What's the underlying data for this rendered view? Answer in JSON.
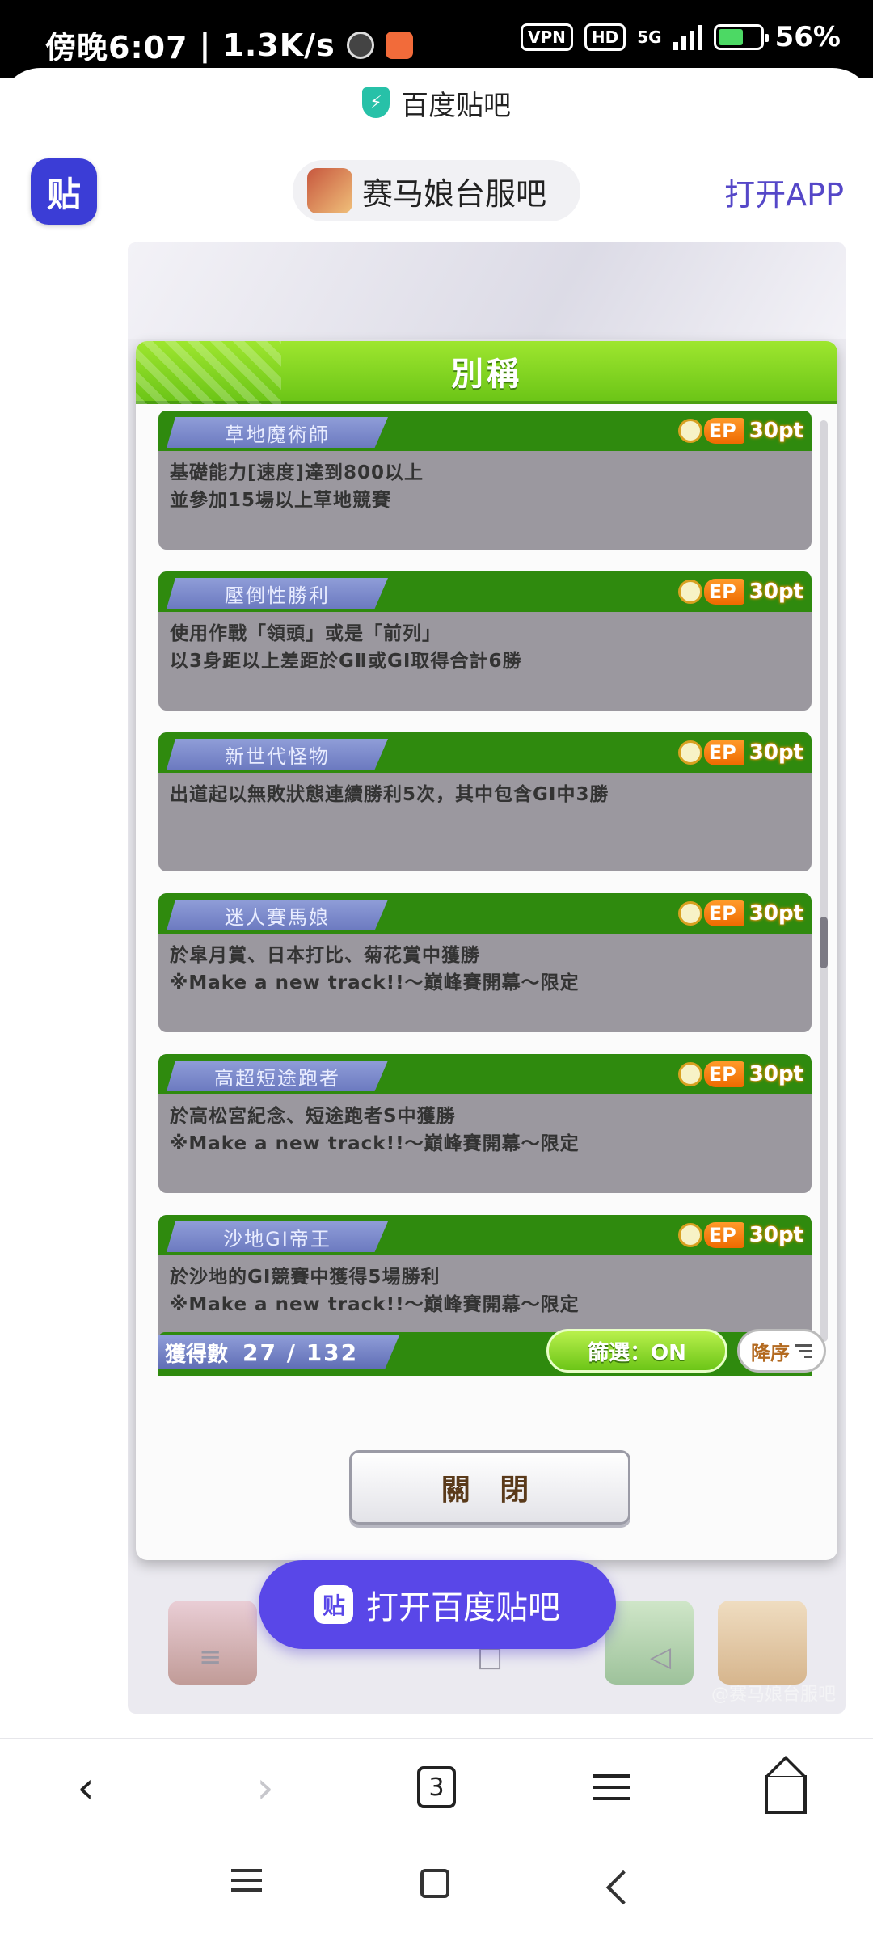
{
  "status_bar": {
    "time": "傍晚6:07",
    "speed": "1.3K/s",
    "vpn": "VPN",
    "hd": "HD",
    "network": "5G",
    "battery": "56%"
  },
  "browser": {
    "site_title": "百度贴吧"
  },
  "tieba_header": {
    "logo_glyph": "贴",
    "forum_name": "赛马娘台服吧",
    "open_app": "打开APP"
  },
  "dialog": {
    "title": "別稱",
    "close_label": "關 閉",
    "cards": [
      {
        "name": "草地魔術師",
        "ep": "EP",
        "points": "30pt",
        "line1": "基礎能力[速度]達到800以上",
        "line2": "並參加15場以上草地競賽"
      },
      {
        "name": "壓倒性勝利",
        "ep": "EP",
        "points": "30pt",
        "line1": "使用作戰「領頭」或是「前列」",
        "line2": "以3身距以上差距於GⅡ或GⅠ取得合計6勝"
      },
      {
        "name": "新世代怪物",
        "ep": "EP",
        "points": "30pt",
        "line1": "出道起以無敗狀態連續勝利5次，其中包含GⅠ中3勝",
        "line2": ""
      },
      {
        "name": "迷人賽馬娘",
        "ep": "EP",
        "points": "30pt",
        "line1": "於皐月賞、日本打比、菊花賞中獲勝",
        "line2": "※Make a new track!!～巔峰賽開幕～限定"
      },
      {
        "name": "高超短途跑者",
        "ep": "EP",
        "points": "30pt",
        "line1": "於高松宮紀念、短途跑者S中獲勝",
        "line2": "※Make a new track!!～巔峰賽開幕～限定"
      },
      {
        "name": "沙地GⅠ帝王",
        "ep": "EP",
        "points": "30pt",
        "line1": "於沙地的GⅠ競賽中獲得5場勝利",
        "line2": "※Make a new track!!～巔峰賽開幕～限定"
      }
    ],
    "count_label": "獲得數",
    "count_value": "27 / 132",
    "filter_label": "篩選：ON",
    "sort_label": "降序"
  },
  "watermark": "@赛马娘台服吧",
  "open_tieba_button": {
    "icon_glyph": "贴",
    "label": "打开百度贴吧"
  },
  "toolbar": {
    "tab_count": "3"
  },
  "colors": {
    "accent": "#5947e8",
    "header_green": "#6cc517",
    "card_green": "#2f8a0e",
    "ep_orange": "#ee6a00"
  }
}
